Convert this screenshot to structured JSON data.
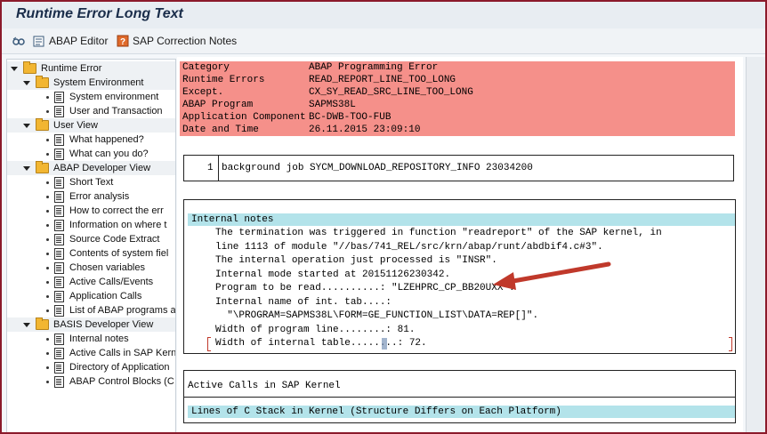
{
  "window": {
    "title": "Runtime Error Long Text"
  },
  "toolbar": {
    "abap_editor_label": "ABAP Editor",
    "sap_notes_label": "SAP Correction Notes"
  },
  "tree": {
    "root": "Runtime Error",
    "groups": [
      {
        "label": "System Environment",
        "items": [
          "System environment",
          "User and Transaction"
        ]
      },
      {
        "label": "User View",
        "items": [
          "What happened?",
          "What can you do?"
        ]
      },
      {
        "label": "ABAP Developer View",
        "items": [
          "Short Text",
          "Error analysis",
          "How to correct the err",
          "Information on where t",
          "Source Code Extract",
          "Contents of system fiel",
          "Chosen variables",
          "Active Calls/Events",
          "Application Calls",
          "List of ABAP programs a"
        ]
      },
      {
        "label": "BASIS Developer View",
        "items": [
          "Internal notes",
          "Active Calls in SAP Kern",
          "Directory of Application",
          "ABAP Control Blocks (C"
        ]
      }
    ]
  },
  "error_info": [
    {
      "label": "Category",
      "value": "ABAP Programming Error"
    },
    {
      "label": "Runtime Errors",
      "value": "READ_REPORT_LINE_TOO_LONG"
    },
    {
      "label": "Except.",
      "value": "CX_SY_READ_SRC_LINE_TOO_LONG"
    },
    {
      "label": "ABAP Program",
      "value": "SAPMS38L"
    },
    {
      "label": "Application Component",
      "value": "BC-DWB-TOO-FUB"
    },
    {
      "label": "Date and Time",
      "value": "26.11.2015 23:09:10"
    }
  ],
  "job": {
    "num": "1",
    "text": "background job SYCM_DOWNLOAD_REPOSITORY_INFO 23034200"
  },
  "internal_notes": {
    "header": "Internal notes",
    "lines": [
      "The termination was triggered in function \"readreport\" of the SAP kernel, in",
      "line 1113 of module \"//bas/741_REL/src/krn/abap/runt/abdbif4.c#3\".",
      "The internal operation just processed is \"INSR\".",
      "Internal mode started at 20151126230342.",
      "Program to be read..........: \"LZEHPRC_CP_BB20UXX\".",
      "Internal name of int. tab....:",
      "  \"\\PROGRAM=SAPMS38L\\FORM=GE_FUNCTION_LIST\\DATA=REP[]\".",
      "Width of program line........: 81.",
      "Width of internal table........: 72."
    ]
  },
  "sections": {
    "active_calls": "Active Calls in SAP Kernel",
    "c_stack": "Lines of C Stack in Kernel (Structure Differs on Each Platform)"
  },
  "colors": {
    "error_bg": "#f5908a",
    "header_bg": "#b3e3ea",
    "arrow": "#c0392b",
    "frame": "#8b1a2b"
  }
}
